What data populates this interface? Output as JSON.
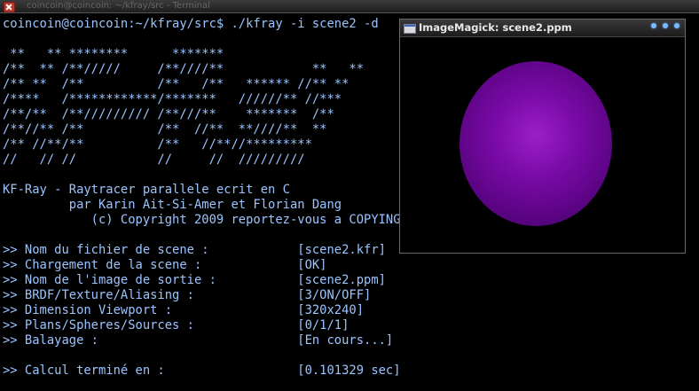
{
  "terminal_title": "coincoin@coincoin: ~/kfray/src - Terminal",
  "terminal": {
    "lines": [
      "coincoin@coincoin:~/kfray/src$ ./kfray -i scene2 -d",
      "",
      " **   ** ********      *******",
      "/**  ** /**/////     /**////**            **   **",
      "/** **  /**          /**   /**   ****** //** **",
      "/****   /************/*******   //////** //***",
      "/**/**  /**///////// /**///**    *******  /**",
      "/**//** /**          /**  //**  **////**  **",
      "/** //**/**          /**   //**//*********",
      "//   // //           //     //  /////////",
      "",
      "KF-Ray - Raytracer parallele ecrit en C",
      "         par Karin Ait-Si-Amer et Florian Dang",
      "            (c) Copyright 2009 reportez-vous a COPYING",
      "",
      ">> Nom du fichier de scene :            [scene2.kfr]",
      ">> Chargement de la scene :             [OK]",
      ">> Nom de l'image de sortie :           [scene2.ppm]",
      ">> BRDF/Texture/Aliasing :              [3/ON/OFF]",
      ">> Dimension Viewport :                 [320x240]",
      ">> Plans/Spheres/Sources :              [0/1/1]",
      ">> Balayage :                           [En cours...]",
      "",
      ">> Calcul terminé en :                  [0.101329 sec]"
    ]
  },
  "imagemagick": {
    "title": "ImageMagick: scene2.ppm",
    "icon": "window-icon",
    "buttons": [
      "minimize",
      "maximize",
      "close"
    ]
  },
  "colors": {
    "terminal_text": "#9bc4ff",
    "background": "#000000",
    "sphere": "#7a0aa8"
  }
}
